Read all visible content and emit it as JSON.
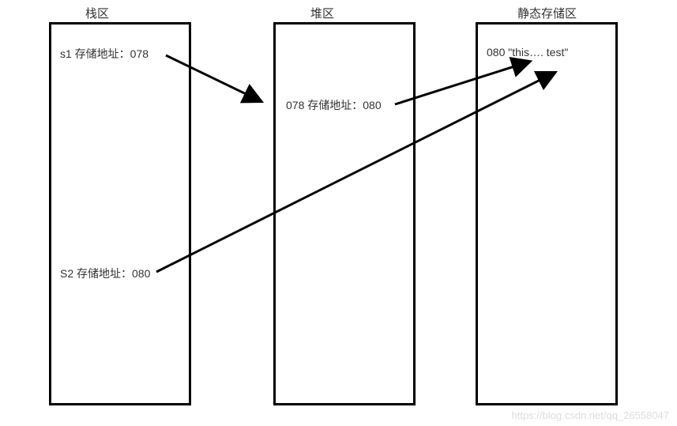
{
  "titles": {
    "stack": "栈区",
    "heap": "堆区",
    "static": "静态存储区"
  },
  "entries": {
    "s1": "s1 存储地址：078",
    "s2": "S2 存储地址：080",
    "heapItem": "078 存储地址：080",
    "staticItem": "080 \"this…. test\""
  },
  "watermark": "https://blog.csdn.net/qq_26558047"
}
